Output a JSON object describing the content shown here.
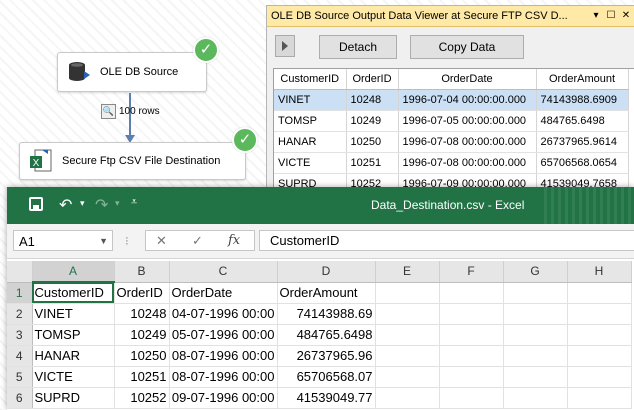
{
  "designer": {
    "source_node": "OLE DB Source",
    "dest_node": "Secure Ftp CSV File Destination",
    "path_label": "100 rows"
  },
  "viewer": {
    "title": "OLE DB Source Output Data Viewer at Secure FTP CSV D...",
    "detach_label": "Detach",
    "copy_label": "Copy Data",
    "columns": [
      "CustomerID",
      "OrderID",
      "OrderDate",
      "OrderAmount"
    ],
    "rows": [
      [
        "VINET",
        "10248",
        "1996-07-04 00:00:00.000",
        "74143988.6909"
      ],
      [
        "TOMSP",
        "10249",
        "1996-07-05 00:00:00.000",
        "484765.6498"
      ],
      [
        "HANAR",
        "10250",
        "1996-07-08 00:00:00.000",
        "26737965.9614"
      ],
      [
        "VICTE",
        "10251",
        "1996-07-08 00:00:00.000",
        "65706568.0654"
      ],
      [
        "SUPRD",
        "10252",
        "1996-07-09 00:00:00.000",
        "41539049.7658"
      ]
    ]
  },
  "excel": {
    "window_title": "Data_Destination.csv  -  Excel",
    "name_box": "A1",
    "formula_value": "CustomerID",
    "column_headers": [
      "A",
      "B",
      "C",
      "D",
      "E",
      "F",
      "G",
      "H"
    ],
    "row_headers": [
      "1",
      "2",
      "3",
      "4",
      "5",
      "6"
    ],
    "rows": [
      [
        "CustomerID",
        "OrderID",
        "OrderDate",
        "OrderAmount",
        "",
        "",
        "",
        ""
      ],
      [
        "VINET",
        "10248",
        "04-07-1996 00:00",
        "74143988.69",
        "",
        "",
        "",
        ""
      ],
      [
        "TOMSP",
        "10249",
        "05-07-1996 00:00",
        "484765.6498",
        "",
        "",
        "",
        ""
      ],
      [
        "HANAR",
        "10250",
        "08-07-1996 00:00",
        "26737965.96",
        "",
        "",
        "",
        ""
      ],
      [
        "VICTE",
        "10251",
        "08-07-1996 00:00",
        "65706568.07",
        "",
        "",
        "",
        ""
      ],
      [
        "SUPRD",
        "10252",
        "09-07-1996 00:00",
        "41539049.77",
        "",
        "",
        "",
        ""
      ]
    ]
  },
  "colors": {
    "excel_green": "#217346",
    "check_green": "#5cb85c",
    "viewer_title_bg": "#ffe9a6"
  }
}
